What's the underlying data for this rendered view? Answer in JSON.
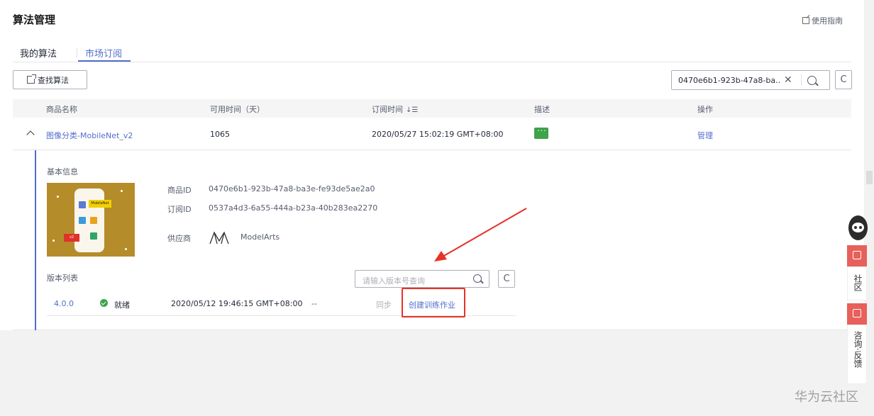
{
  "header": {
    "title": "算法管理",
    "guide": "使用指南"
  },
  "tabs": [
    {
      "label": "我的算法"
    },
    {
      "label": "市场订阅"
    }
  ],
  "toolbar": {
    "find": "查找算法",
    "search_value": "0470e6b1-923b-47a8-ba...",
    "refresh_symbol": "C"
  },
  "table": {
    "headers": [
      "商品名称",
      "可用时间（天）",
      "订阅时间",
      "描述",
      "操作"
    ],
    "row": {
      "name": "图像分类-MobileNet_v2",
      "days": "1065",
      "time": "2020/05/27 15:02:19 GMT+08:00",
      "action": "管理"
    }
  },
  "detail": {
    "basic_title": "基本信息",
    "thumb": {
      "tag1": "MobileNet",
      "tag2": "v2"
    },
    "product_id_label": "商品ID",
    "product_id": "0470e6b1-923b-47a8-ba3e-fe93de5ae2a0",
    "order_id_label": "订阅ID",
    "order_id": "0537a4d3-6a55-444a-b23a-40b283ea2270",
    "vendor_label": "供应商",
    "vendor": "ModelArts",
    "version_title": "版本列表",
    "version_search_placeholder": "请输入版本号查询",
    "version": {
      "ver": "4.0.0",
      "status": "就绪",
      "time": "2020/05/12 19:46:15 GMT+08:00",
      "dash": "--",
      "sync": "同步",
      "create": "创建训练作业"
    }
  },
  "sidebar": {
    "community": "社区",
    "feedback": "咨询·反馈"
  },
  "watermark": "华为云社区",
  "colors": {
    "accent": "#526ecc",
    "highlight": "#e63228",
    "ok": "#3ea34a"
  }
}
